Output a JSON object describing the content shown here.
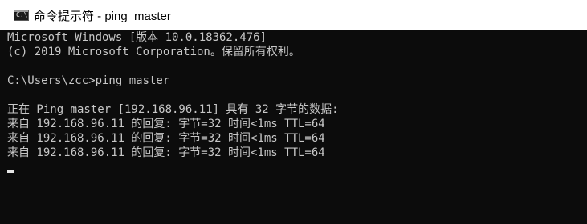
{
  "window": {
    "title": "命令提示符 - ping  master",
    "icon": "cmd-icon",
    "icon_text": "C:\\"
  },
  "console": {
    "lines": [
      "Microsoft Windows [版本 10.0.18362.476]",
      "(c) 2019 Microsoft Corporation。保留所有权利。",
      "",
      "C:\\Users\\zcc>ping master",
      "",
      "正在 Ping master [192.168.96.11] 具有 32 字节的数据:",
      "来自 192.168.96.11 的回复: 字节=32 时间<1ms TTL=64",
      "来自 192.168.96.11 的回复: 字节=32 时间<1ms TTL=64",
      "来自 192.168.96.11 的回复: 字节=32 时间<1ms TTL=64"
    ]
  },
  "colors": {
    "console_bg": "#0c0c0c",
    "console_fg": "#c7c7c7",
    "titlebar_bg": "#ffffff"
  }
}
